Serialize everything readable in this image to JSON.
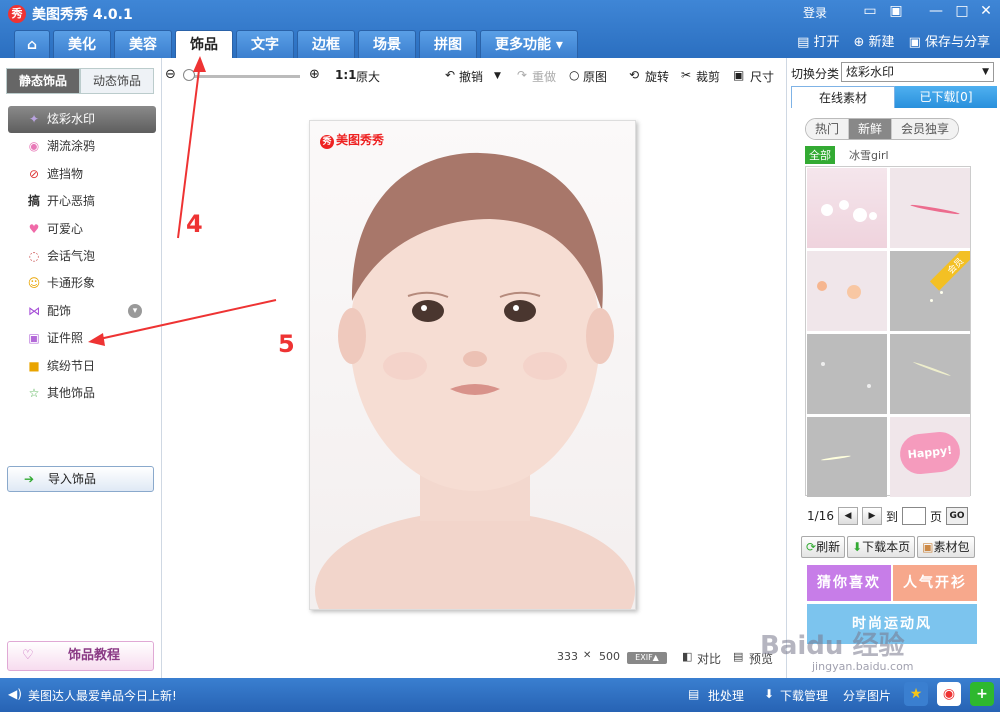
{
  "app": {
    "title": "美图秀秀 4.0.1",
    "logo_char": "秀"
  },
  "window_controls": {
    "login": "登录",
    "minimize": "—",
    "maximize": "□",
    "close": "✕"
  },
  "tabs": [
    {
      "label": "⌂",
      "icon": "home-icon"
    },
    {
      "label": "美化"
    },
    {
      "label": "美容"
    },
    {
      "label": "饰品",
      "active": true
    },
    {
      "label": "文字"
    },
    {
      "label": "边框"
    },
    {
      "label": "场景"
    },
    {
      "label": "拼图"
    },
    {
      "label": "更多功能 ▾"
    }
  ],
  "top_actions": {
    "open": "打开",
    "new": "新建",
    "save_share": "保存与分享"
  },
  "left": {
    "subtabs": [
      "静态饰品",
      "动态饰品"
    ],
    "categories": [
      {
        "label": "炫彩水印",
        "icon": "sparkle-icon",
        "glyph": "✦"
      },
      {
        "label": "潮流涂鸦",
        "icon": "lips-icon",
        "glyph": "◉"
      },
      {
        "label": "遮挡物",
        "icon": "block-icon",
        "glyph": "⊘"
      },
      {
        "label": "开心恶搞",
        "icon": "funny-icon",
        "glyph": "搞"
      },
      {
        "label": "可爱心",
        "icon": "heart-icon",
        "glyph": "♥"
      },
      {
        "label": "会话气泡",
        "icon": "speech-bubble-icon",
        "glyph": "◌"
      },
      {
        "label": "卡通形象",
        "icon": "cartoon-icon",
        "glyph": "☺"
      },
      {
        "label": "配饰",
        "icon": "bow-icon",
        "glyph": "⋈"
      },
      {
        "label": "证件照",
        "icon": "id-photo-icon",
        "glyph": "▣"
      },
      {
        "label": "缤纷节日",
        "icon": "gift-icon",
        "glyph": "■"
      },
      {
        "label": "其他饰品",
        "icon": "star-outline-icon",
        "glyph": "☆"
      }
    ],
    "import_label": "导入饰品",
    "tutorial_label": "饰品教程"
  },
  "toolbar": {
    "zoom_ratio": "1:1",
    "original_size": "原大",
    "undo": "撤销",
    "redo": "重做",
    "original": "原图",
    "rotate": "旋转",
    "crop": "裁剪",
    "size": "尺寸"
  },
  "photo": {
    "watermark": "美图秀秀",
    "width_px": "333",
    "times": "✕",
    "height_px": "500",
    "exif": "EXIF▲",
    "compare": "对比",
    "preview": "预览"
  },
  "right": {
    "switch_label": "切换分类",
    "switch_value": "炫彩水印",
    "tabs": [
      "在线素材",
      "已下载[0]"
    ],
    "pills": [
      "热门",
      "新鲜",
      "会员独享"
    ],
    "all_badge": "全部",
    "tag": "冰雪girl",
    "member_badge": "会员",
    "happy_text": "Happy!",
    "pager": {
      "current": "1/16",
      "to": "到",
      "page": "页",
      "go": "GO"
    },
    "actions": [
      "刷新",
      "下载本页",
      "素材包"
    ],
    "promos": [
      "猜你喜欢",
      "人气开衫",
      "时尚运动风"
    ]
  },
  "status": {
    "ticker": "美图达人最爱单品今日上新!",
    "batch": "批处理",
    "download_mgr": "下载管理",
    "share_pic": "分享图片"
  },
  "annotations": {
    "step4": "4",
    "step5": "5"
  },
  "watermark": {
    "text": "Baidu 经验",
    "url": "jingyan.baidu.com"
  },
  "colors": {
    "titlebar": "#2b6fc0",
    "accent_red": "#e33333",
    "active_green": "#33aa33"
  }
}
